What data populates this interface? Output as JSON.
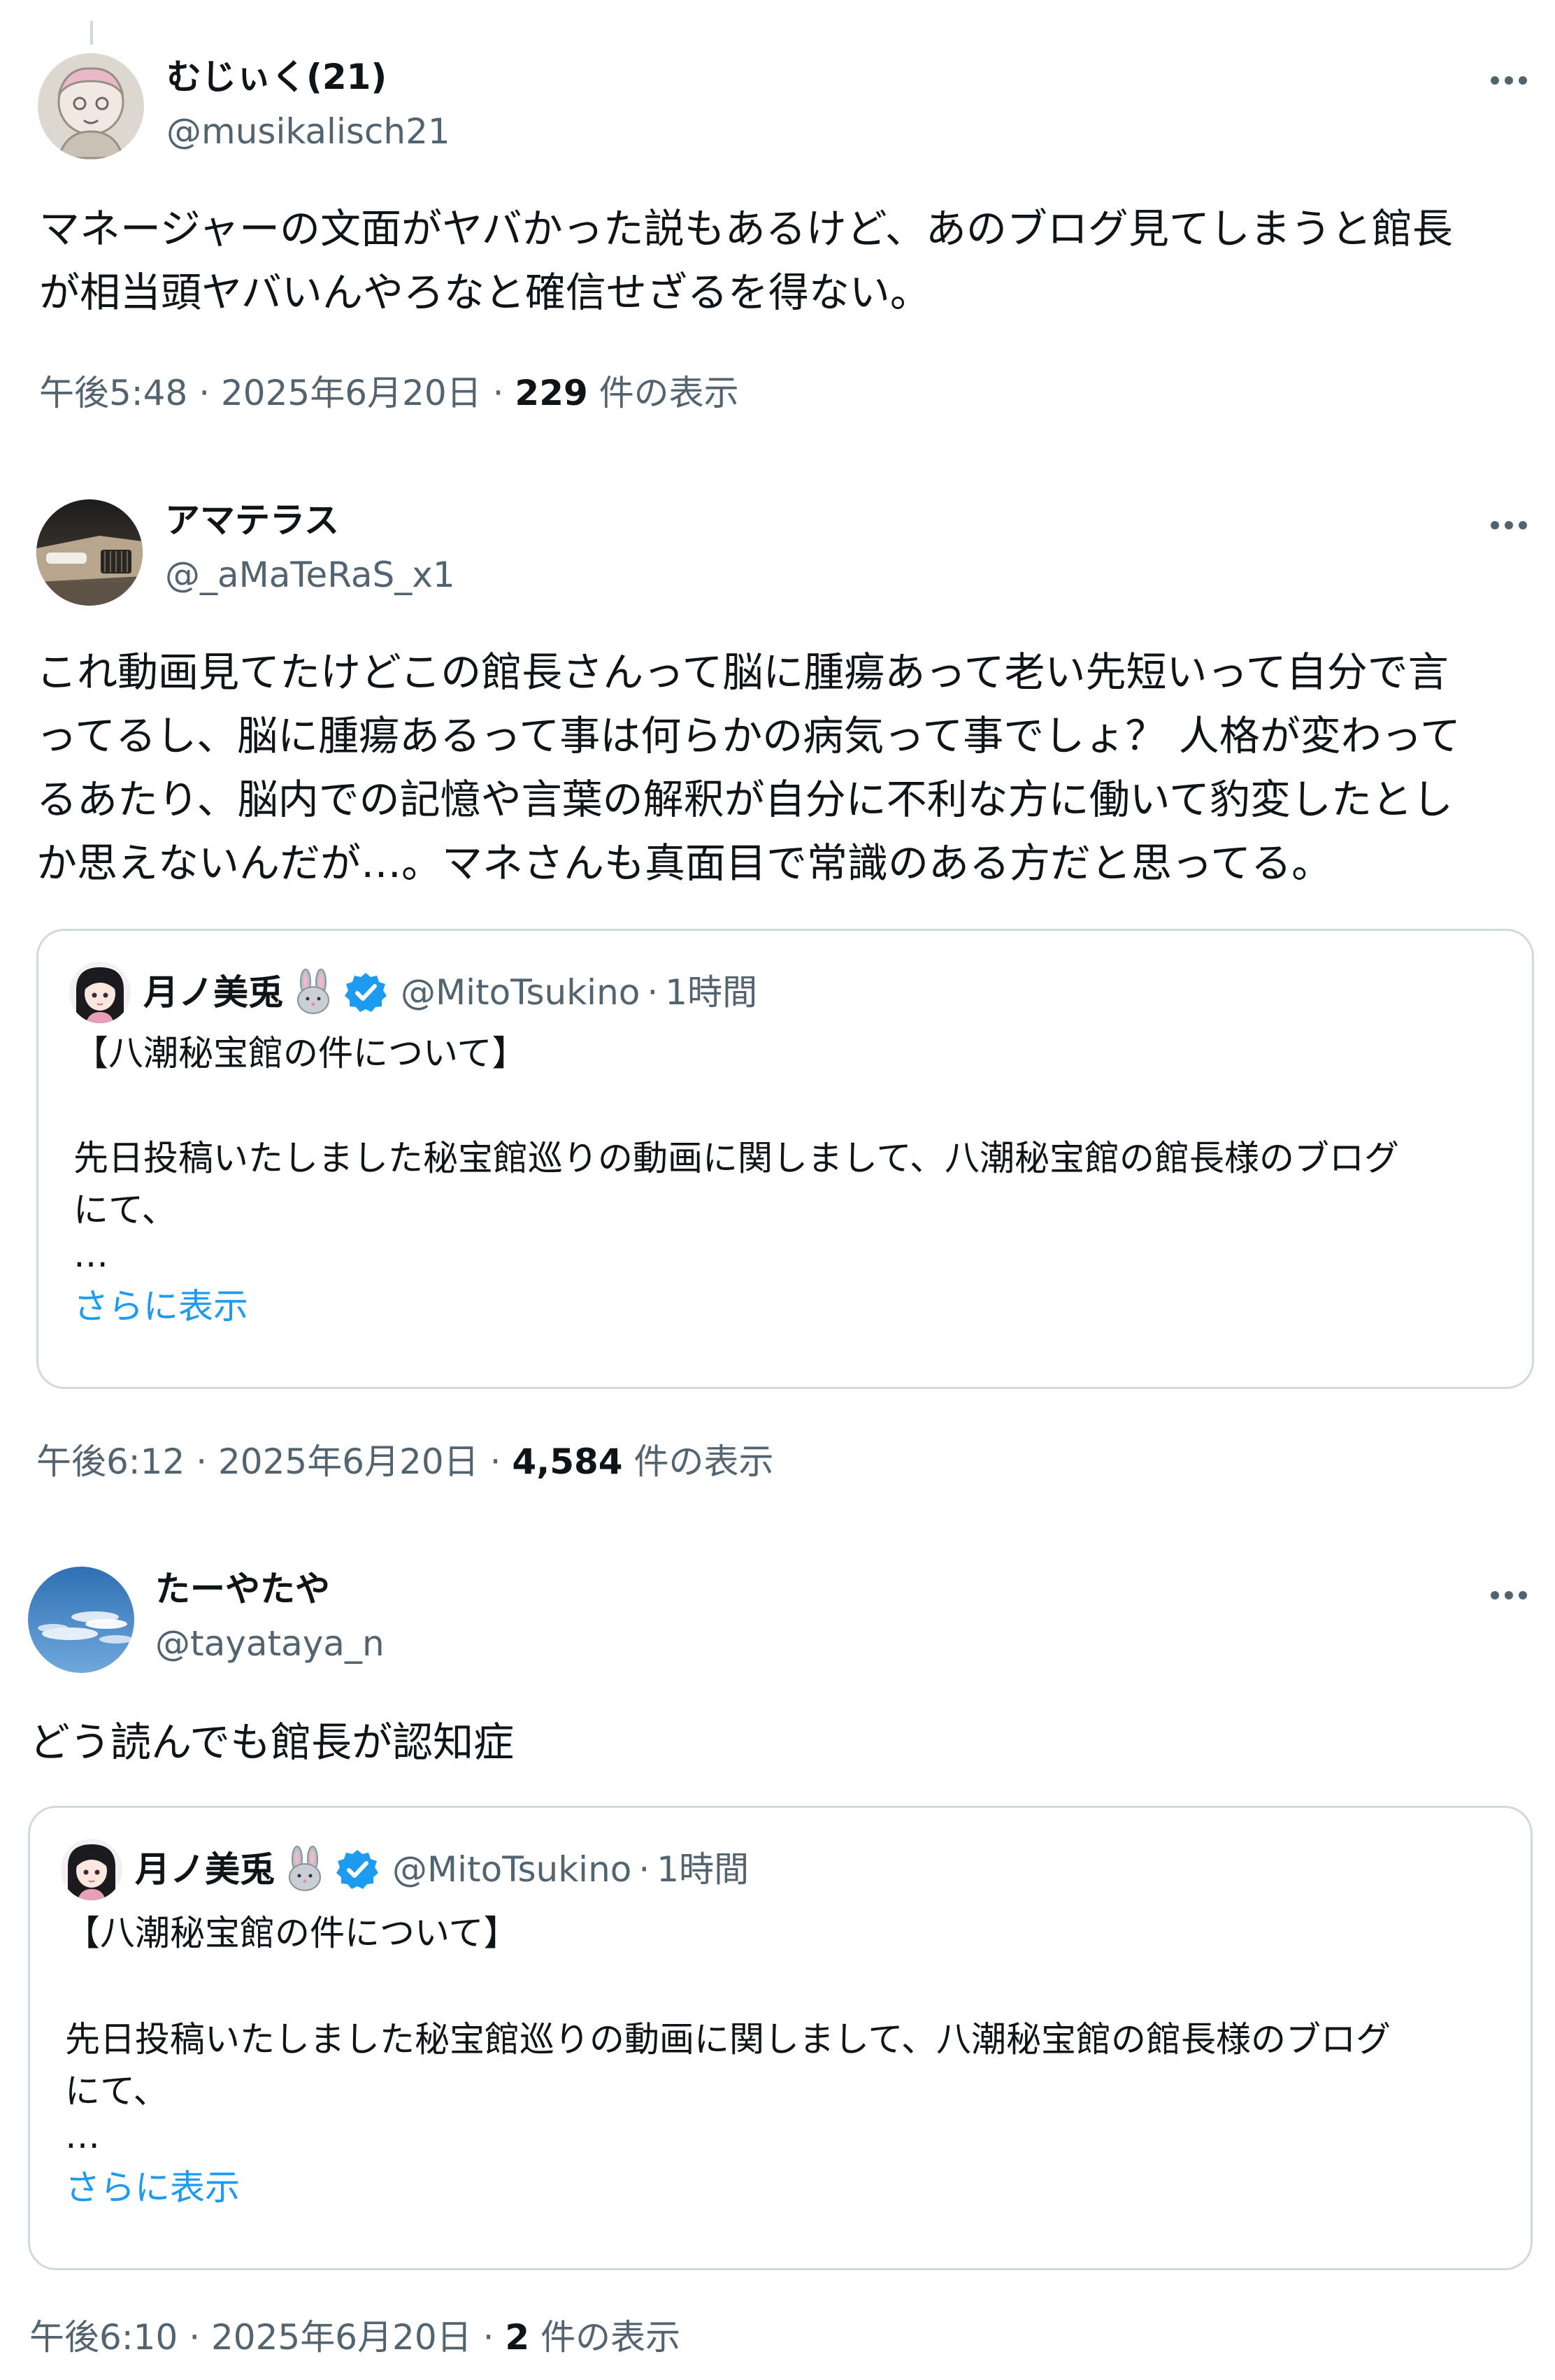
{
  "colors": {
    "text_primary": "#0f1419",
    "text_secondary": "#536471",
    "link": "#1d9bf0",
    "border": "#cfd9de",
    "verified": "#1d9bf0"
  },
  "posts": [
    {
      "name": "むじぃく(21)",
      "handle": "@musikalisch21",
      "more_icon": "more-horizontal-icon",
      "body_lines": [
        "マネージャーの文面がヤバかった説もあるけど、あのブログ見てしまうと館長",
        "が相当頭ヤバいんやろなと確信せざるを得ない。"
      ],
      "meta": {
        "time": "午後5:48",
        "sep1": "·",
        "date": "2025年6月20日",
        "sep2": "·",
        "views": "229",
        "views_label": "件の表示"
      }
    },
    {
      "name": "アマテラス",
      "handle": "@_aMaTeRaS_x1",
      "more_icon": "more-horizontal-icon",
      "body_lines": [
        "これ動画見てたけどこの館長さんって脳に腫瘍あって老い先短いって自分で言",
        "ってるし、脳に腫瘍あるって事は何らかの病気って事でしょ？ 人格が変わって",
        "るあたり、脳内での記憶や言葉の解釈が自分に不利な方に働いて豹変したとし",
        "か思えないんだが…。マネさんも真面目で常識のある方だと思ってる。"
      ],
      "quote": {
        "name": "月ノ美兎",
        "emoji": "🐰",
        "verified_icon": "verified-badge-icon",
        "handle": "@MitoTsukino",
        "sep": "·",
        "time": "1時間",
        "lines": [
          "【八潮秘宝館の件について】",
          "",
          "先日投稿いたしました秘宝館巡りの動画に関しまして、八潮秘宝館の館長様のブログ",
          "にて、",
          "…"
        ],
        "show_more": "さらに表示"
      },
      "meta": {
        "time": "午後6:12",
        "sep1": "·",
        "date": "2025年6月20日",
        "sep2": "·",
        "views": "4,584",
        "views_label": "件の表示"
      }
    },
    {
      "name": "たーやたや",
      "handle": "@tayataya_n",
      "more_icon": "more-horizontal-icon",
      "body_lines": [
        "どう読んでも館長が認知症"
      ],
      "quote": {
        "name": "月ノ美兎",
        "emoji": "🐰",
        "verified_icon": "verified-badge-icon",
        "handle": "@MitoTsukino",
        "sep": "·",
        "time": "1時間",
        "lines": [
          "【八潮秘宝館の件について】",
          "",
          "先日投稿いたしました秘宝館巡りの動画に関しまして、八潮秘宝館の館長様のブログ",
          "にて、",
          "…"
        ],
        "show_more": "さらに表示"
      },
      "meta": {
        "time": "午後6:10",
        "sep1": "·",
        "date": "2025年6月20日",
        "sep2": "·",
        "views": "2",
        "views_label": "件の表示"
      }
    }
  ]
}
